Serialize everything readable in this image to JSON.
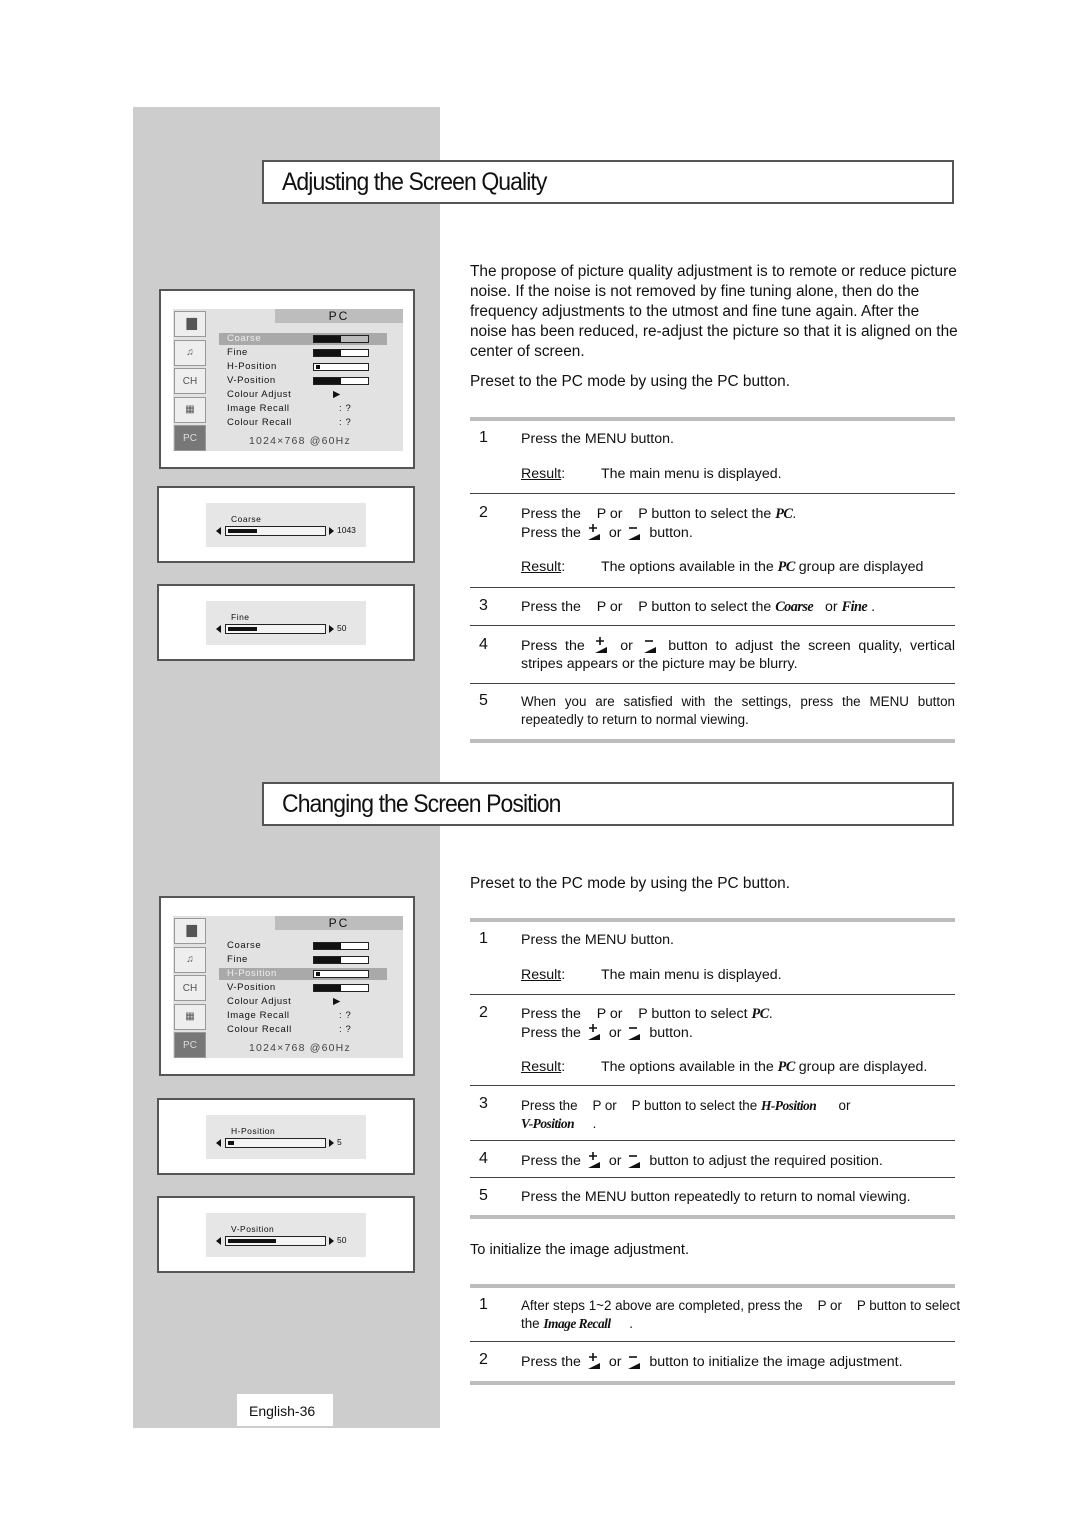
{
  "section1": {
    "title": "Adjusting the Screen Quality",
    "intro": "The propose of picture quality adjustment is to remote or reduce picture noise. If the noise is not removed by fine tuning alone, then do the frequency adjustments to the utmost and fine tune again. After the noise has been reduced, re-adjust the picture so that it is aligned on the center of screen.",
    "preset": "Preset to the PC mode by using the PC button.",
    "result_label": "Result",
    "steps": [
      {
        "num": "1",
        "text": "Press the MENU button.",
        "result": "The main menu is displayed."
      },
      {
        "num": "2",
        "line1_a": "Press the    P or    P button to select the ",
        "line1_em": "PC",
        "line1_b": ".",
        "line2_a": "Press the",
        "line2_or": "or",
        "line2_b": "button.",
        "result_a": "The options available in the ",
        "result_em": "PC",
        "result_b": " group are displayed"
      },
      {
        "num": "3",
        "text_a": "Press the    P or    P button to select the ",
        "em1": "Coarse",
        "mid": "   or ",
        "em2": "Fine",
        "end": " ."
      },
      {
        "num": "4",
        "a": "Press the",
        "or": "or",
        "b": "button to adjust the screen quality, vertical stripes appears or the picture may be blurry."
      },
      {
        "num": "5",
        "text": "When you are satisfied with the settings, press the MENU button repeatedly to return to normal viewing."
      }
    ],
    "osd_menu": {
      "header": "PC",
      "items": [
        {
          "label": "Coarse",
          "type": "bar",
          "value": 0.5,
          "selected": true
        },
        {
          "label": "Fine",
          "type": "bar",
          "value": 0.5,
          "selected": false
        },
        {
          "label": "H-Position",
          "type": "bar",
          "value": 0.05,
          "selected": false
        },
        {
          "label": "V-Position",
          "type": "bar",
          "value": 0.5,
          "selected": false
        },
        {
          "label": "Colour Adjust",
          "type": "arrow",
          "value_text": "▶"
        },
        {
          "label": "Image Recall",
          "type": "text",
          "value_text": ": ?"
        },
        {
          "label": "Colour Recall",
          "type": "text",
          "value_text": ": ?"
        }
      ],
      "resolution": "1024×768  @60Hz"
    },
    "sliders": [
      {
        "label": "Coarse",
        "value_text": "1043",
        "fill": 0.3
      },
      {
        "label": "Fine",
        "value_text": "50",
        "fill": 0.3
      }
    ]
  },
  "section2": {
    "title": "Changing the Screen Position",
    "preset": "Preset to the PC mode by using the PC button.",
    "result_label": "Result",
    "steps": [
      {
        "num": "1",
        "text": "Press the MENU button.",
        "result": "The main menu is displayed."
      },
      {
        "num": "2",
        "line1_a": "Press the    P or    P button to select ",
        "line1_em": "PC",
        "line1_b": ".",
        "line2_a": "Press the",
        "line2_or": "or",
        "line2_b": "button.",
        "result_a": "The options available in the ",
        "result_em": "PC",
        "result_b": " group are displayed."
      },
      {
        "num": "3",
        "text_a": "Press the    P or    P button to select the ",
        "em1": "H-Position",
        "mid": "      or",
        "em2": "V-Position",
        "end": "     ."
      },
      {
        "num": "4",
        "a": "Press the",
        "or": "or",
        "b": "button to adjust the required position."
      },
      {
        "num": "5",
        "text": "Press the MENU button repeatedly to return to nomal viewing."
      }
    ],
    "osd_menu": {
      "header": "PC",
      "items": [
        {
          "label": "Coarse",
          "type": "bar",
          "value": 0.5,
          "selected": false
        },
        {
          "label": "Fine",
          "type": "bar",
          "value": 0.5,
          "selected": false
        },
        {
          "label": "H-Position",
          "type": "bar",
          "value": 0.05,
          "selected": true
        },
        {
          "label": "V-Position",
          "type": "bar",
          "value": 0.5,
          "selected": false
        },
        {
          "label": "Colour Adjust",
          "type": "arrow",
          "value_text": "▶"
        },
        {
          "label": "Image Recall",
          "type": "text",
          "value_text": ": ?"
        },
        {
          "label": "Colour Recall",
          "type": "text",
          "value_text": ": ?"
        }
      ],
      "resolution": "1024×768  @60Hz"
    },
    "sliders": [
      {
        "label": "H-Position",
        "value_text": "5",
        "fill": 0.05
      },
      {
        "label": "V-Position",
        "value_text": "50",
        "fill": 0.5
      }
    ]
  },
  "init": {
    "heading": "To initialize the image adjustment.",
    "steps": [
      {
        "num": "1",
        "text_a": "After steps 1~2 above are completed, press the    P or    P button to select the ",
        "em": "Image Recall",
        "end": "     ."
      },
      {
        "num": "2",
        "a": "Press the",
        "or": "or",
        "b": "button to initialize the image adjustment."
      }
    ]
  },
  "footer": {
    "page": "English-36"
  },
  "icons": [
    "picture-icon",
    "sound-icon",
    "channel-icon",
    "setup-icon",
    "pc-icon"
  ]
}
